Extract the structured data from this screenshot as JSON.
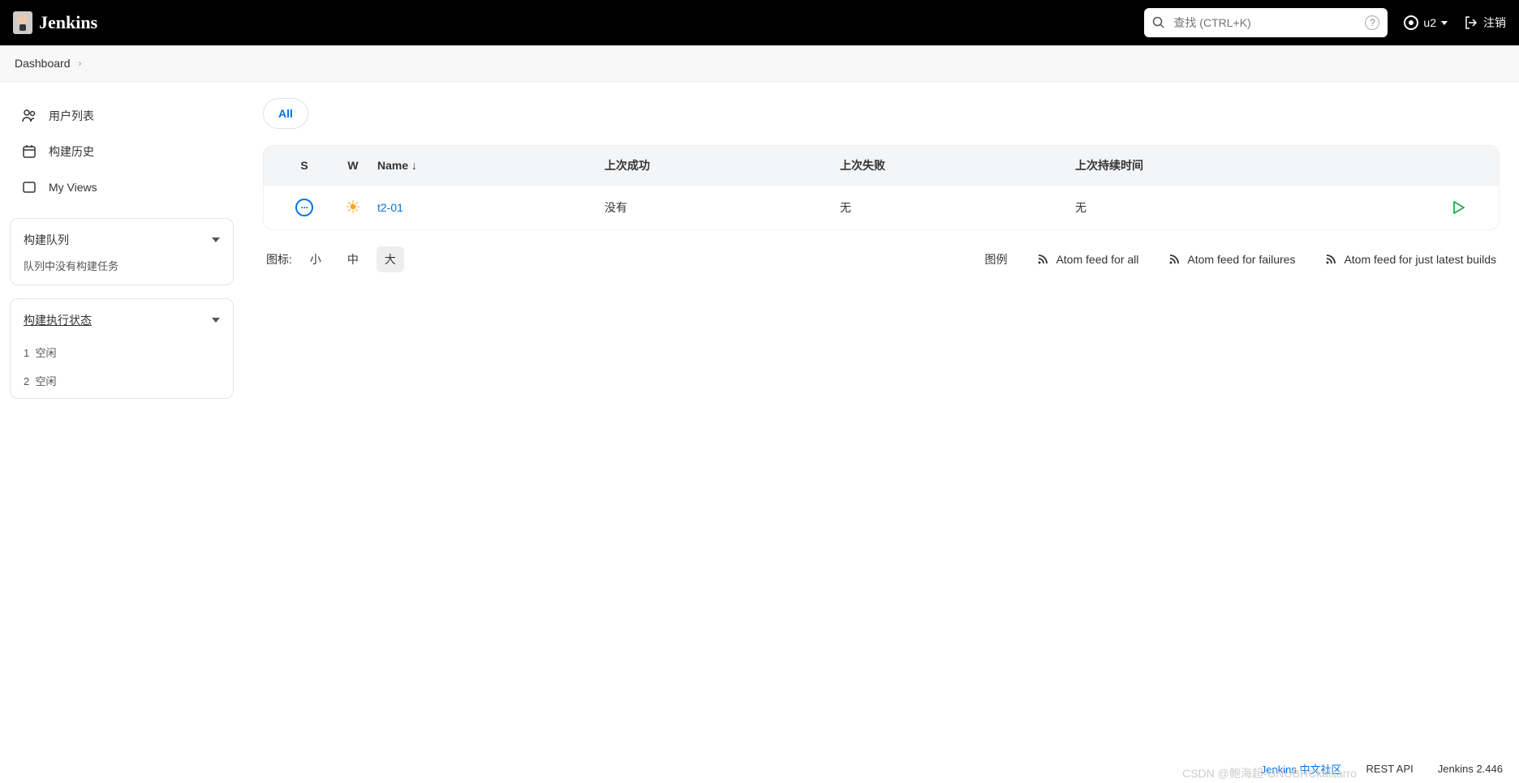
{
  "header": {
    "brand": "Jenkins",
    "search_placeholder": "查找 (CTRL+K)",
    "user": "u2",
    "logout": "注销"
  },
  "breadcrumb": {
    "items": [
      "Dashboard"
    ]
  },
  "sidebar": {
    "links": [
      {
        "label": "用户列表",
        "icon": "people-icon"
      },
      {
        "label": "构建历史",
        "icon": "history-icon"
      },
      {
        "label": "My Views",
        "icon": "views-icon"
      }
    ],
    "queue": {
      "title": "构建队列",
      "empty": "队列中没有构建任务"
    },
    "executors": {
      "title": "构建执行状态",
      "items": [
        {
          "num": "1",
          "status": "空闲"
        },
        {
          "num": "2",
          "status": "空闲"
        }
      ]
    }
  },
  "tabs": {
    "all": "All"
  },
  "table": {
    "headers": {
      "s": "S",
      "w": "W",
      "name": "Name ↓",
      "last_success": "上次成功",
      "last_failure": "上次失败",
      "last_duration": "上次持续时间"
    },
    "rows": [
      {
        "name": "t2-01",
        "last_success": "没有",
        "last_failure": "无",
        "last_duration": "无"
      }
    ]
  },
  "toolbar": {
    "icon_label": "图标:",
    "sizes": {
      "s": "小",
      "m": "中",
      "l": "大"
    },
    "legend": "图例",
    "feed_all": "Atom feed for all",
    "feed_failures": "Atom feed for failures",
    "feed_latest": "Atom feed for just latest builds"
  },
  "footer": {
    "community": "Jenkins 中文社区",
    "rest_api": "REST API",
    "version": "Jenkins 2.446"
  },
  "watermark": "CSDN @鲍海超-GNUBHCkalitarro"
}
